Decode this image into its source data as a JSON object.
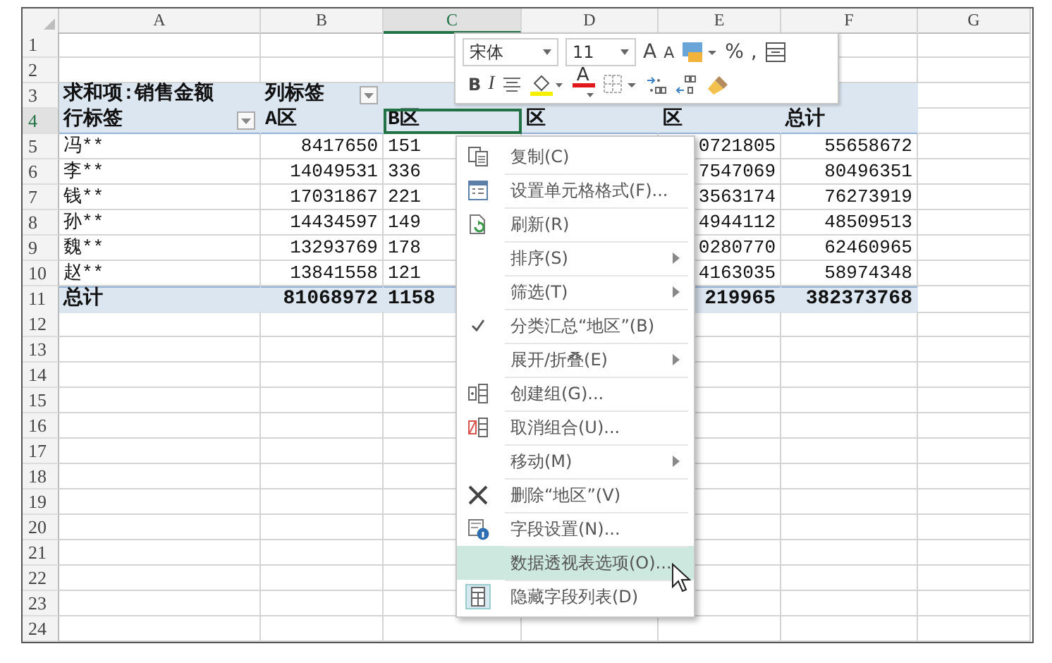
{
  "columns": [
    "A",
    "B",
    "C",
    "D",
    "E",
    "F",
    "G"
  ],
  "rows": [
    {
      "number": "1",
      "kind": "blank"
    },
    {
      "number": "2",
      "kind": "blank"
    },
    {
      "number": "3",
      "kind": "values_header",
      "a": "求和项:销售金额",
      "b": "列标签"
    },
    {
      "number": "4",
      "kind": "column_labels",
      "cells": [
        {
          "text": "行标签",
          "selected": false
        },
        {
          "text": "A区",
          "selected": false
        },
        {
          "text": "B区",
          "selected": true
        },
        {
          "text": "区",
          "selected": false
        },
        {
          "text": "区",
          "selected": false
        },
        {
          "text": "总计",
          "selected": false
        }
      ]
    },
    {
      "number": "5",
      "kind": "data",
      "a": "冯**",
      "b": "8417650",
      "c": "151",
      "e": "0721805",
      "f": "55658672"
    },
    {
      "number": "6",
      "kind": "data",
      "a": "李**",
      "b": "14049531",
      "c": "336",
      "e": "7547069",
      "f": "80496351"
    },
    {
      "number": "7",
      "kind": "data",
      "a": "钱**",
      "b": "17031867",
      "c": "221",
      "e": "3563174",
      "f": "76273919"
    },
    {
      "number": "8",
      "kind": "data",
      "a": "孙**",
      "b": "14434597",
      "c": "149",
      "e": "4944112",
      "f": "48509513"
    },
    {
      "number": "9",
      "kind": "data",
      "a": "魏**",
      "b": "13293769",
      "c": "178",
      "e": "0280770",
      "f": "62460965"
    },
    {
      "number": "10",
      "kind": "data",
      "a": "赵**",
      "b": "13841558",
      "c": "121",
      "e": "4163035",
      "f": "58974348"
    },
    {
      "number": "11",
      "kind": "total",
      "a": "总计",
      "b": "81068972",
      "c": "1158",
      "e": "219965",
      "f": "382373768"
    },
    {
      "number": "12",
      "kind": "blank"
    },
    {
      "number": "13",
      "kind": "blank"
    },
    {
      "number": "14",
      "kind": "blank"
    },
    {
      "number": "15",
      "kind": "blank"
    },
    {
      "number": "16",
      "kind": "blank"
    },
    {
      "number": "17",
      "kind": "blank"
    },
    {
      "number": "18",
      "kind": "blank"
    },
    {
      "number": "19",
      "kind": "blank"
    },
    {
      "number": "20",
      "kind": "blank"
    },
    {
      "number": "21",
      "kind": "blank"
    },
    {
      "number": "22",
      "kind": "blank"
    },
    {
      "number": "23",
      "kind": "blank"
    },
    {
      "number": "24",
      "kind": "blank"
    }
  ],
  "mini_toolbar": {
    "font": "宋体",
    "size": "11",
    "grow_font": "A",
    "shrink_font": "A",
    "percent": "%",
    "comma": ",",
    "bold": "B",
    "italic": "I",
    "font_color": "A"
  },
  "context_menu": [
    {
      "label": "复制(C)",
      "submenu": false,
      "checked": false,
      "selected": false
    },
    {
      "label": "设置单元格格式(F)...",
      "submenu": false,
      "checked": false,
      "selected": false
    },
    {
      "label": "刷新(R)",
      "submenu": false,
      "checked": false,
      "selected": false
    },
    {
      "label": "排序(S)",
      "submenu": true,
      "checked": false,
      "selected": false
    },
    {
      "label": "筛选(T)",
      "submenu": true,
      "checked": false,
      "selected": false
    },
    {
      "label": "分类汇总“地区”(B)",
      "submenu": false,
      "checked": true,
      "selected": false
    },
    {
      "label": "展开/折叠(E)",
      "submenu": true,
      "checked": false,
      "selected": false
    },
    {
      "label": "创建组(G)...",
      "submenu": false,
      "checked": false,
      "selected": false
    },
    {
      "label": "取消组合(U)...",
      "submenu": false,
      "checked": false,
      "selected": false
    },
    {
      "label": "移动(M)",
      "submenu": true,
      "checked": false,
      "selected": false
    },
    {
      "label": "删除“地区”(V)",
      "submenu": false,
      "checked": false,
      "selected": false
    },
    {
      "label": "字段设置(N)...",
      "submenu": false,
      "checked": false,
      "selected": false
    },
    {
      "label": "数据透视表选项(O)...",
      "submenu": false,
      "checked": false,
      "selected": true
    },
    {
      "label": "隐藏字段列表(D)",
      "submenu": false,
      "checked": false,
      "selected": false
    }
  ]
}
